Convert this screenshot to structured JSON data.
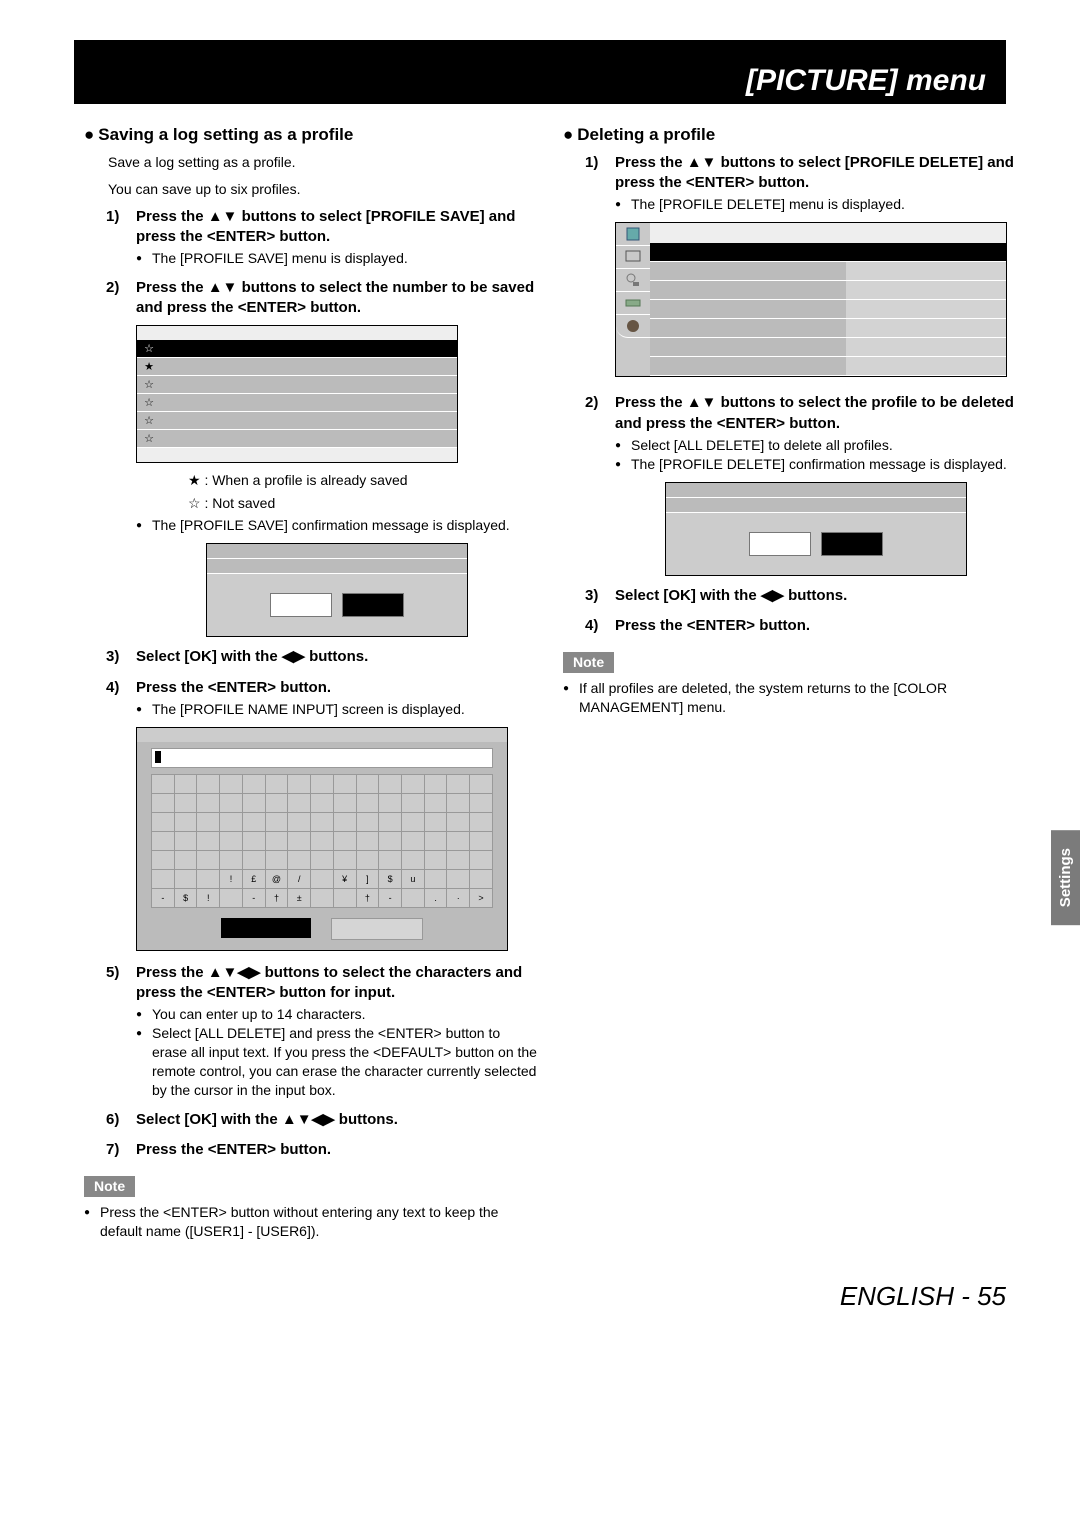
{
  "header": {
    "title": "[PICTURE] menu"
  },
  "side_tab": "Settings",
  "footer": "ENGLISH - 55",
  "left": {
    "heading": "Saving a log setting as a profile",
    "intro1": "Save a log setting as a profile.",
    "intro2": "You can save up to six profiles.",
    "step1": "Press the ▲▼ buttons to select [PROFILE SAVE] and press the <ENTER> button.",
    "step1_sub1": "The [PROFILE SAVE] menu is displayed.",
    "step2": "Press the ▲▼ buttons to select the number to be saved and press the <ENTER> button.",
    "legend_saved": "★ : When a profile is already saved",
    "legend_notsaved": "☆ : Not saved",
    "step2_sub1": "The [PROFILE SAVE] confirmation message is displayed.",
    "step3": "Select [OK] with the ◀▶ buttons.",
    "step4": "Press the <ENTER> button.",
    "step4_sub1": "The [PROFILE NAME INPUT] screen is displayed.",
    "step5": "Press the ▲▼◀▶ buttons to select the characters and press the <ENTER> button for input.",
    "step5_sub1": "You can enter up to 14 characters.",
    "step5_sub2": "Select [ALL DELETE] and press the <ENTER> button to erase all input text. If you press the <DEFAULT> button on the remote control, you can erase the character currently selected by the cursor in the input box.",
    "step6": "Select [OK] with the ▲▼◀▶ buttons.",
    "step7": "Press the <ENTER> button.",
    "note_label": "Note",
    "note1": "Press the <ENTER> button without entering any text to keep the default name ([USER1] - [USER6])."
  },
  "right": {
    "heading": "Deleting a profile",
    "step1": "Press the ▲▼ buttons to select [PROFILE DELETE] and press the <ENTER> button.",
    "step1_sub1": "The [PROFILE DELETE] menu is displayed.",
    "step2": "Press the ▲▼ buttons to select the profile to be deleted and press the <ENTER> button.",
    "step2_sub1": "Select [ALL DELETE] to delete all profiles.",
    "step2_sub2": "The [PROFILE DELETE] confirmation message is displayed.",
    "step3": "Select [OK] with the ◀▶ buttons.",
    "step4": "Press the <ENTER> button.",
    "note_label": "Note",
    "note1": "If all profiles are deleted, the system returns to the [COLOR MANAGEMENT] menu."
  },
  "profile_rows": [
    "☆",
    "★",
    "☆",
    "☆",
    "☆",
    "☆"
  ]
}
